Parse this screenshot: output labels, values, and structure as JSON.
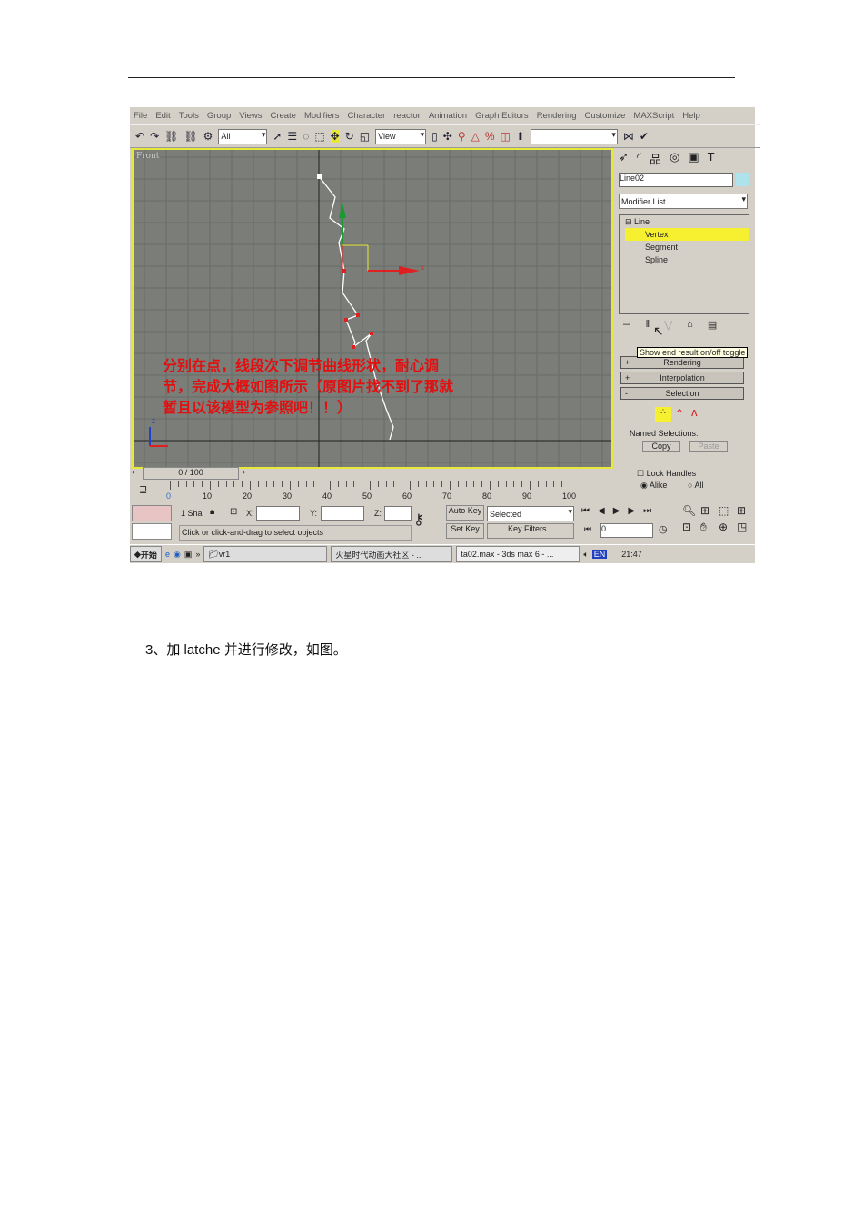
{
  "menu": [
    "File",
    "Edit",
    "Tools",
    "Group",
    "Views",
    "Create",
    "Modifiers",
    "Character",
    "reactor",
    "Animation",
    "Graph Editors",
    "Rendering",
    "Customize",
    "MAXScript",
    "Help"
  ],
  "toolbar": {
    "selection_filter": "All",
    "coord_system": "View",
    "named_set": ""
  },
  "viewport": {
    "label": "Front",
    "note": "分别在点，线段次下调节曲线形状，耐心调节，完成大概如图所示（原图片找不到了那就暂且以该模型为参照吧！！）",
    "axis_x": "x",
    "axis_z": "z"
  },
  "panel": {
    "object_name": "Line02",
    "modifier_list": "Modifier List",
    "stack": [
      "Line",
      "Vertex",
      "Segment",
      "Spline"
    ],
    "tooltip": "Show end result on/off toggle",
    "rollouts": [
      {
        "sign": "+",
        "label": "Rendering"
      },
      {
        "sign": "+",
        "label": "Interpolation"
      },
      {
        "sign": "-",
        "label": "Selection"
      }
    ],
    "named_selections": "Named Selections:",
    "copy": "Copy",
    "paste": "Paste",
    "lock_handles": "Lock Handles",
    "alike": "Alike",
    "all": "All"
  },
  "timeline": {
    "frame": "0 / 100",
    "ticks": [
      "0",
      "10",
      "20",
      "30",
      "40",
      "50",
      "60",
      "70",
      "80",
      "90",
      "100"
    ]
  },
  "status": {
    "selected_count": "1 Sha",
    "x_label": "X:",
    "y_label": "Y:",
    "z_label": "Z:",
    "prompt": "Click or click-and-drag to select objects",
    "auto_key": "Auto Key",
    "set_key": "Set Key",
    "key_mode": "Selected",
    "key_filters": "Key Filters...",
    "current_frame": "0"
  },
  "taskbar": {
    "start": "开始",
    "items": [
      "vr1",
      "火星时代动画大社区 - ...",
      "ta02.max - 3ds max 6 - ..."
    ],
    "lang": "EN",
    "clock": "21:47"
  },
  "caption": "3、加 latche 并进行修改，如图。"
}
